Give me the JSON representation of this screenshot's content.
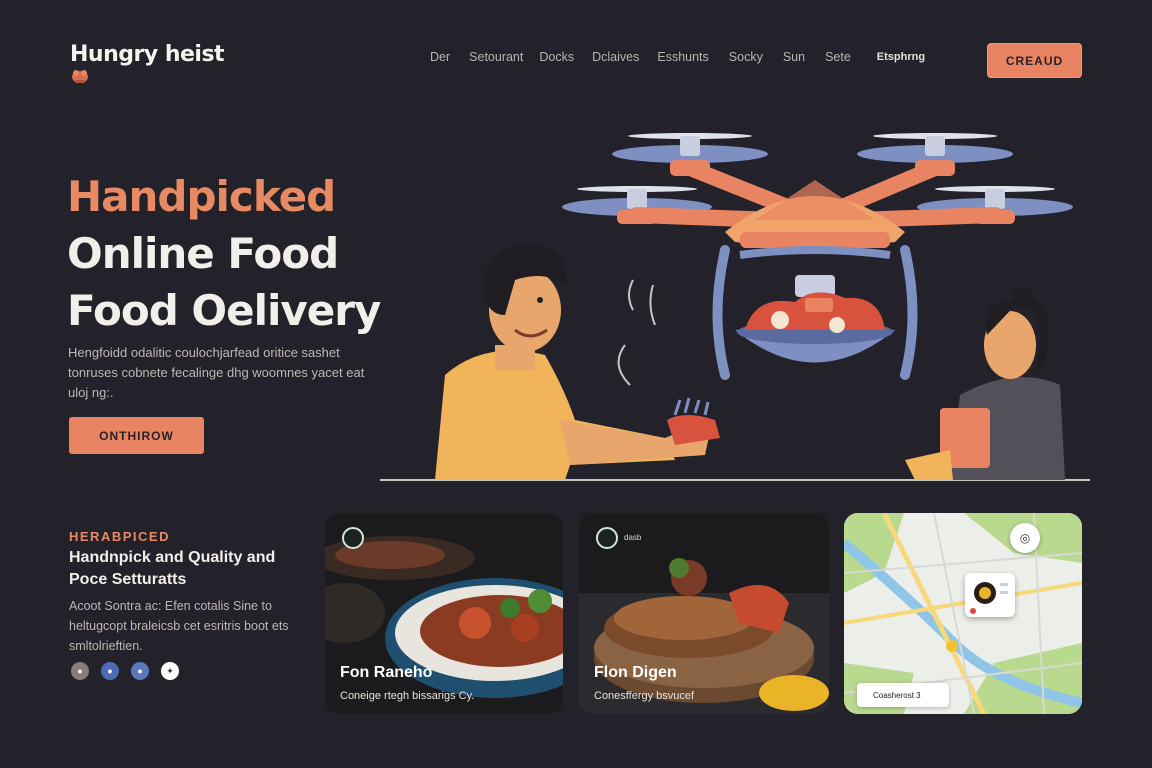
{
  "brand": {
    "name": "Hungry heist"
  },
  "nav": {
    "items": [
      "Der",
      "Setourant",
      "Docks",
      "Dclaives",
      "Esshunts",
      "Socky",
      "Sun",
      "Sete"
    ],
    "last": "Etsphrng",
    "cta": "CREAUD"
  },
  "hero": {
    "line1": "Handpicked",
    "line2": "Online Food",
    "line3": "Food Oelivery",
    "description": "Hengfoidd odalitic coulochjarfead oritice sashet tonruses cobnete fecalinge dhg woomnes yacet eat uloj ng:.",
    "cta": "ONTHIROW"
  },
  "section": {
    "kicker": "HERABPICED",
    "title": "Handnpick and Quality and Poce Setturatts",
    "description": "Acoot Sontra ac: Efen cotalis Sine to heltugcopt braleicsb cet esritris boot ets smltolrieftien."
  },
  "cards": [
    {
      "title": "Fon Raneho",
      "subtitle": "Coneige rtegh bissarigs Cy."
    },
    {
      "title": "Flon Digen",
      "subtitle": "Conesffergy bsvucef",
      "badge": "dasb"
    }
  ],
  "map": {
    "label": "Coasherost 3"
  },
  "colors": {
    "background": "#23212a",
    "accent": "#e98462",
    "drone": "#e98462",
    "rotor": "#7e8fc2"
  },
  "icons": [
    "brand-logo-icon",
    "drone-illustration",
    "compass-icon",
    "location-pin-icon",
    "social-icon"
  ]
}
